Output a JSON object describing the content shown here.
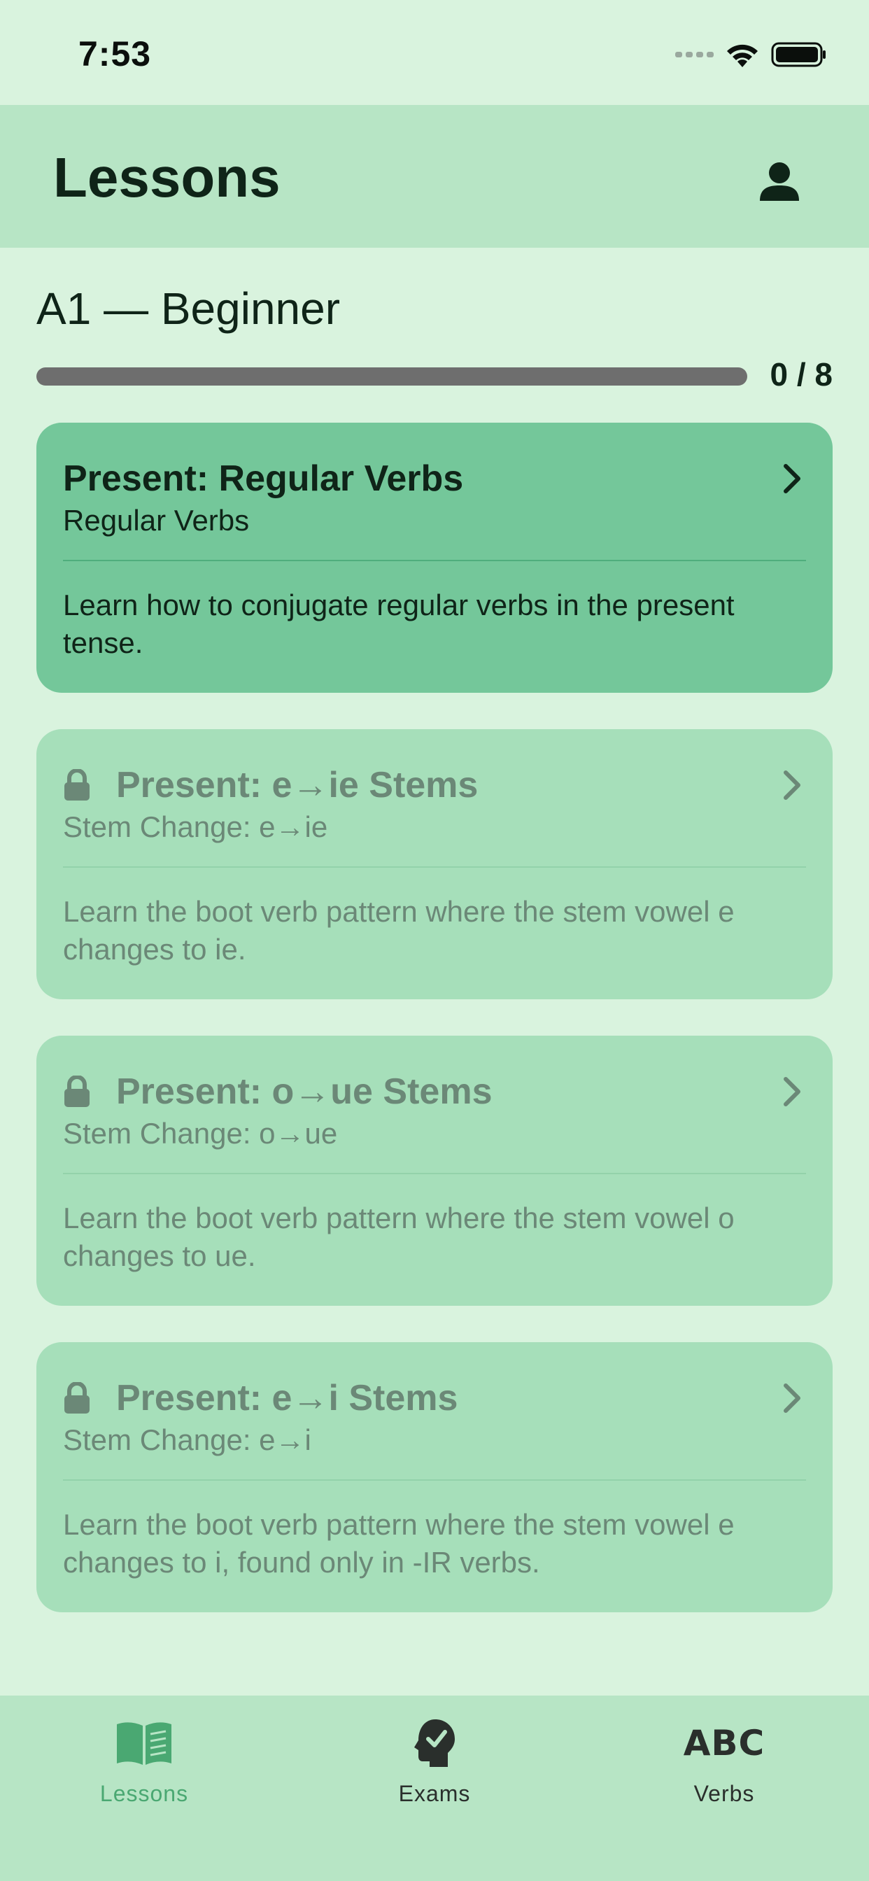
{
  "status_bar": {
    "time": "7:53"
  },
  "header": {
    "title": "Lessons"
  },
  "level": {
    "title": "A1 — Beginner",
    "progress_text": "0 / 8",
    "progress_fraction": 0.0
  },
  "lessons": [
    {
      "title": "Present: Regular Verbs",
      "subtitle": "Regular Verbs",
      "description": "Learn how to conjugate regular verbs in the present tense.",
      "locked": false
    },
    {
      "title": "Present: e→ie Stems",
      "subtitle": "Stem Change: e→ie",
      "description": "Learn the boot verb pattern where the stem vowel e changes to ie.",
      "locked": true
    },
    {
      "title": "Present: o→ue Stems",
      "subtitle": "Stem Change: o→ue",
      "description": "Learn the boot verb pattern where the stem vowel o changes to ue.",
      "locked": true
    },
    {
      "title": "Present: e→i Stems",
      "subtitle": "Stem Change: e→i",
      "description": "Learn the boot verb pattern where the stem vowel e changes to i, found only in -IR verbs.",
      "locked": true
    }
  ],
  "tabs": [
    {
      "label": "Lessons",
      "icon": "book-icon",
      "active": true
    },
    {
      "label": "Exams",
      "icon": "head-check-icon",
      "active": false
    },
    {
      "label": "Verbs",
      "icon": "abc-icon",
      "icon_text": "ABC",
      "active": false
    }
  ],
  "colors": {
    "background": "#d9f3de",
    "header": "#b7e5c5",
    "active_card": "#74c79a",
    "locked_card": "#a6dfba",
    "accent": "#4aa872"
  }
}
